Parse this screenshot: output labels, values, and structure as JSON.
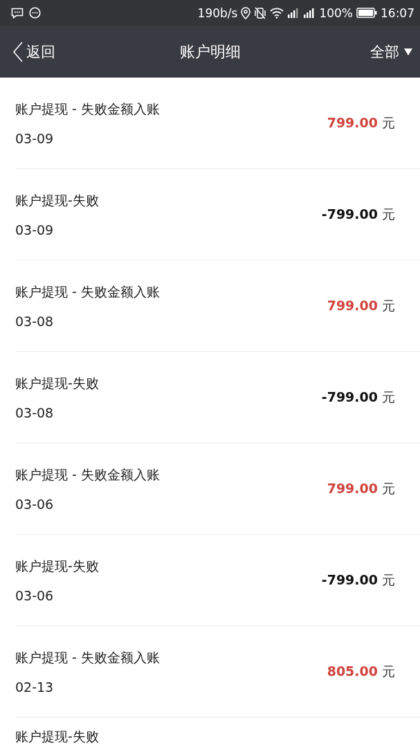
{
  "status_bar": {
    "speed": "190b/s",
    "battery": "100%",
    "time": "16:07"
  },
  "nav": {
    "back": "返回",
    "title": "账户明细",
    "filter": "全部"
  },
  "records": [
    {
      "title": "账户提现 - 失败金额入账",
      "date": "03-09",
      "amount": "799.00",
      "unit": "元",
      "kind": "credit"
    },
    {
      "title": "账户提现-失败",
      "date": "03-09",
      "amount": "-799.00",
      "unit": "元",
      "kind": "debit"
    },
    {
      "title": "账户提现 - 失败金额入账",
      "date": "03-08",
      "amount": "799.00",
      "unit": "元",
      "kind": "credit"
    },
    {
      "title": "账户提现-失败",
      "date": "03-08",
      "amount": "-799.00",
      "unit": "元",
      "kind": "debit"
    },
    {
      "title": "账户提现 - 失败金额入账",
      "date": "03-06",
      "amount": "799.00",
      "unit": "元",
      "kind": "credit"
    },
    {
      "title": "账户提现-失败",
      "date": "03-06",
      "amount": "-799.00",
      "unit": "元",
      "kind": "debit"
    },
    {
      "title": "账户提现 - 失败金额入账",
      "date": "02-13",
      "amount": "805.00",
      "unit": "元",
      "kind": "credit"
    },
    {
      "title": "账户提现-失败"
    }
  ]
}
